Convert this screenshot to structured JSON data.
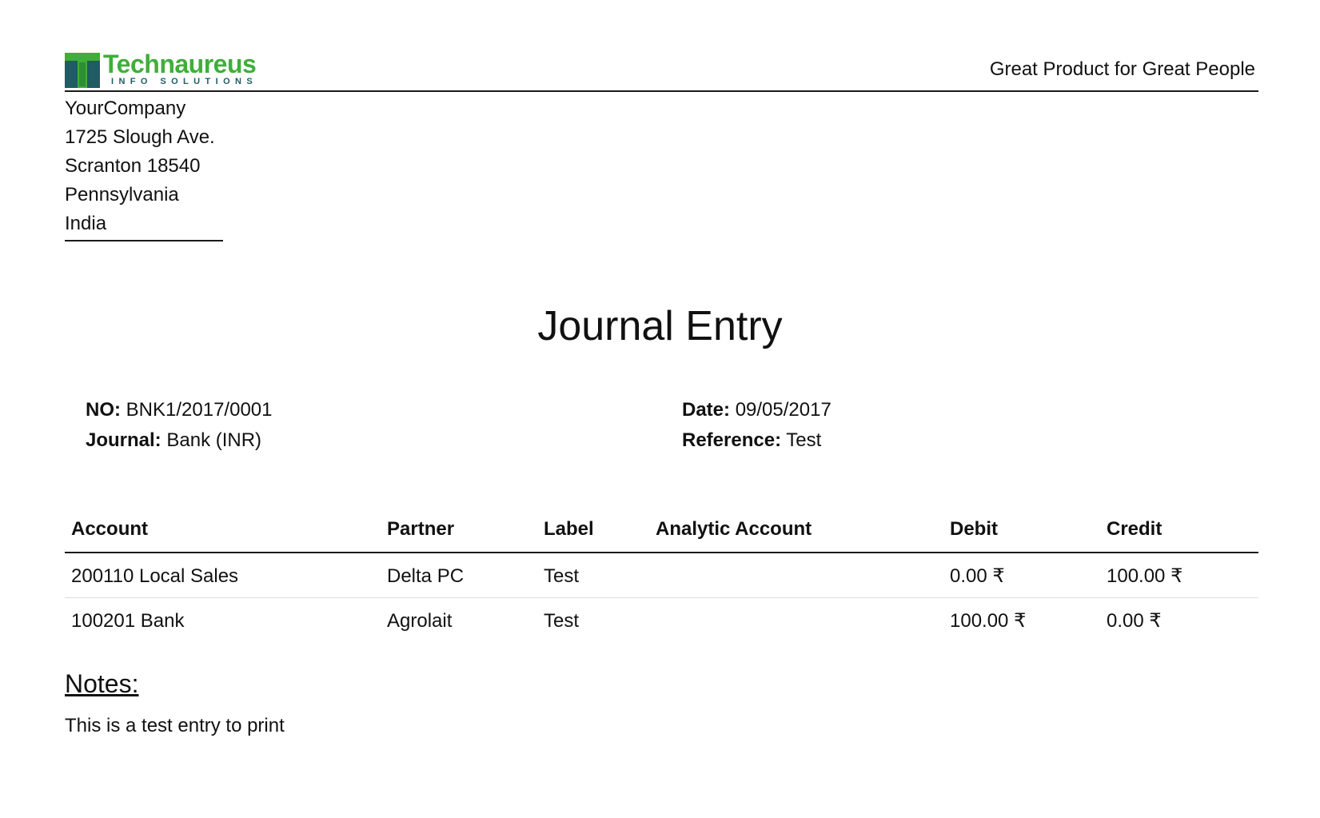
{
  "header": {
    "logo": {
      "name": "Technaureus",
      "subtitle": "INFO SOLUTIONS",
      "colors": {
        "green": "#3fae3a",
        "teal": "#1f5c63"
      }
    },
    "tagline": "Great Product for Great People"
  },
  "company": {
    "lines": [
      "YourCompany",
      "1725 Slough Ave.",
      "Scranton 18540",
      "Pennsylvania",
      "India"
    ]
  },
  "document": {
    "title": "Journal Entry",
    "number_label": "NO:",
    "number_value": "BNK1/2017/0001",
    "journal_label": "Journal:",
    "journal_value": "Bank (INR)",
    "date_label": "Date:",
    "date_value": "09/05/2017",
    "reference_label": "Reference:",
    "reference_value": "Test"
  },
  "table": {
    "columns": [
      "Account",
      "Partner",
      "Label",
      "Analytic Account",
      "Debit",
      "Credit"
    ],
    "rows": [
      {
        "account": "200110 Local Sales",
        "partner": "Delta PC",
        "label": "Test",
        "analytic": "",
        "debit": "0.00 ₹",
        "credit": "100.00 ₹"
      },
      {
        "account": "100201 Bank",
        "partner": "Agrolait",
        "label": "Test",
        "analytic": "",
        "debit": "100.00 ₹",
        "credit": "0.00 ₹"
      }
    ]
  },
  "notes": {
    "title": "Notes:",
    "text": "This is a test entry to print"
  }
}
